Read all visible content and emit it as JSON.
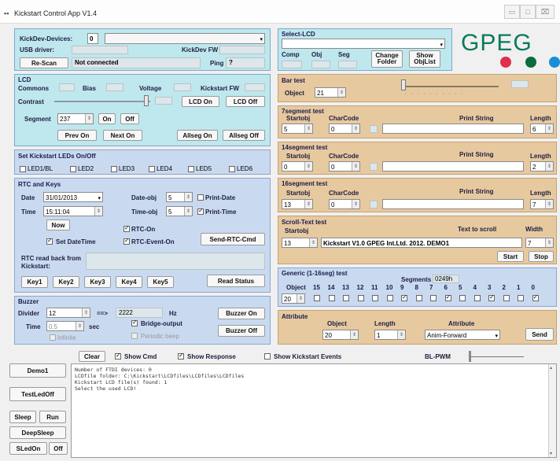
{
  "window": {
    "title": "Kickstart Control App V1.4",
    "min": "▭",
    "max": "□",
    "close": "⌧"
  },
  "devices": {
    "label": "KickDev-Devices:",
    "count": "0",
    "usb_label": "USB driver:",
    "fw_label": "KickDev FW",
    "rescan": "Re-Scan",
    "status": "Not connected",
    "ping_label": "Ping",
    "ping_value": "?"
  },
  "select_lcd": {
    "title": "Select-LCD",
    "comp": "Comp",
    "obj": "Obj",
    "seg": "Seg",
    "change_folder": "Change Folder",
    "show_objlist": "Show ObjList"
  },
  "logo": {
    "text": "GPEG",
    "dots": [
      "#e0304a",
      "#0c6b3a",
      "#1a8fd6"
    ]
  },
  "lcd": {
    "title": "LCD",
    "commons": "Commons",
    "bias": "Bias",
    "voltage": "Voltage",
    "kickstart_fw": "Kickstart FW",
    "contrast": "Contrast",
    "lcd_on": "LCD On",
    "lcd_off": "LCD Off",
    "segment_label": "Segment",
    "segment_value": "237",
    "on": "On",
    "off": "Off",
    "prev_on": "Prev On",
    "next_on": "Next On",
    "allseg_on": "Allseg On",
    "allseg_off": "Allseg Off"
  },
  "leds": {
    "title": "Set Kickstart LEDs On/Off",
    "items": [
      "LED1/BL",
      "LED2",
      "LED3",
      "LED4",
      "LED5",
      "LED6"
    ]
  },
  "rtc": {
    "title": "RTC and Keys",
    "date_label": "Date",
    "date_value": "31/01/2013",
    "time_label": "Time",
    "time_value": "15:11:04",
    "date_obj_label": "Date-obj",
    "date_obj_value": "5",
    "time_obj_label": "Time-obj",
    "time_obj_value": "5",
    "print_date": "Print-Date",
    "print_time": "Print-Time",
    "now": "Now",
    "rtc_on": "RTC-On",
    "set_datetime": "Set DateTime",
    "rtc_event_on": "RTC-Event-On",
    "send_rtc": "Send-RTC-Cmd",
    "readback_label": "RTC read back from Kickstart:",
    "keys": [
      "Key1",
      "Key2",
      "Key3",
      "Key4",
      "Key5"
    ],
    "read_status": "Read Status"
  },
  "buzzer": {
    "title": "Buzzer",
    "divider_label": "Divider",
    "divider_value": "12",
    "arrow": "==>",
    "freq_value": "2222",
    "hz": "Hz",
    "time_label": "Time",
    "time_value": "0.5",
    "sec": "sec",
    "bridge_output": "Bridge-output",
    "infinite": "Infinite",
    "periodic_beep": "Periodic beep",
    "buzzer_on": "Buzzer On",
    "buzzer_off": "Buzzer Off"
  },
  "bar_test": {
    "title": "Bar test",
    "object_label": "Object",
    "object_value": "21"
  },
  "seg7": {
    "title": "7segment test",
    "startobj": "Startobj",
    "charcode": "CharCode",
    "print_string": "Print String",
    "length": "Length",
    "startobj_value": "5",
    "charcode_value": "0",
    "length_value": "6"
  },
  "seg14": {
    "title": "14segment test",
    "startobj": "Startobj",
    "charcode": "CharCode",
    "print_string": "Print String",
    "length": "Length",
    "startobj_value": "0",
    "charcode_value": "0",
    "length_value": "2"
  },
  "seg16": {
    "title": "16segment test",
    "startobj": "Startobj",
    "charcode": "CharCode",
    "print_string": "Print String",
    "length": "Length",
    "startobj_value": "13",
    "charcode_value": "0",
    "length_value": "7"
  },
  "scroll": {
    "title": "Scroll-Text test",
    "startobj": "Startobj",
    "text_label": "Text to scroll",
    "width_label": "Width",
    "startobj_value": "13",
    "text_value": "Kickstart V1.0  GPEG Int.Ltd. 2012. DEMO1",
    "width_value": "7",
    "start": "Start",
    "stop": "Stop"
  },
  "generic": {
    "title": "Generic (1-16seg) test",
    "segments_label": "Segments",
    "segments_value": "0249h",
    "object_label": "Object",
    "object_value": "20",
    "bits": [
      "15",
      "14",
      "13",
      "12",
      "11",
      "10",
      "9",
      "8",
      "7",
      "6",
      "5",
      "4",
      "3",
      "2",
      "1",
      "0"
    ],
    "checked": [
      false,
      false,
      false,
      false,
      false,
      false,
      true,
      false,
      false,
      true,
      false,
      false,
      true,
      false,
      false,
      true
    ]
  },
  "attribute": {
    "title": "Attribute",
    "object_label": "Object",
    "length_label": "Length",
    "attribute_label": "Attribute",
    "object_value": "20",
    "length_value": "1",
    "attribute_value": "Anim-Forward",
    "send": "Send"
  },
  "bottom": {
    "clear": "Clear",
    "show_cmd": "Show Cmd",
    "show_response": "Show Response",
    "show_events": "Show Kickstart Events",
    "bl_pwm": "BL-PWM",
    "demo1": "Demo1",
    "testledoff": "TestLedOff",
    "sleep": "Sleep",
    "run": "Run",
    "deepsleep": "DeepSleep",
    "sledon": "SLedOn",
    "off": "Off",
    "log": [
      "Number of FTDI devices: 0",
      "LCDfile folder: C:\\Kickstart\\LCDfiles\\LCDfiles\\LCDfiles",
      "Kickstart LCD file(s) found: 1",
      "Select the used LCD!"
    ]
  }
}
